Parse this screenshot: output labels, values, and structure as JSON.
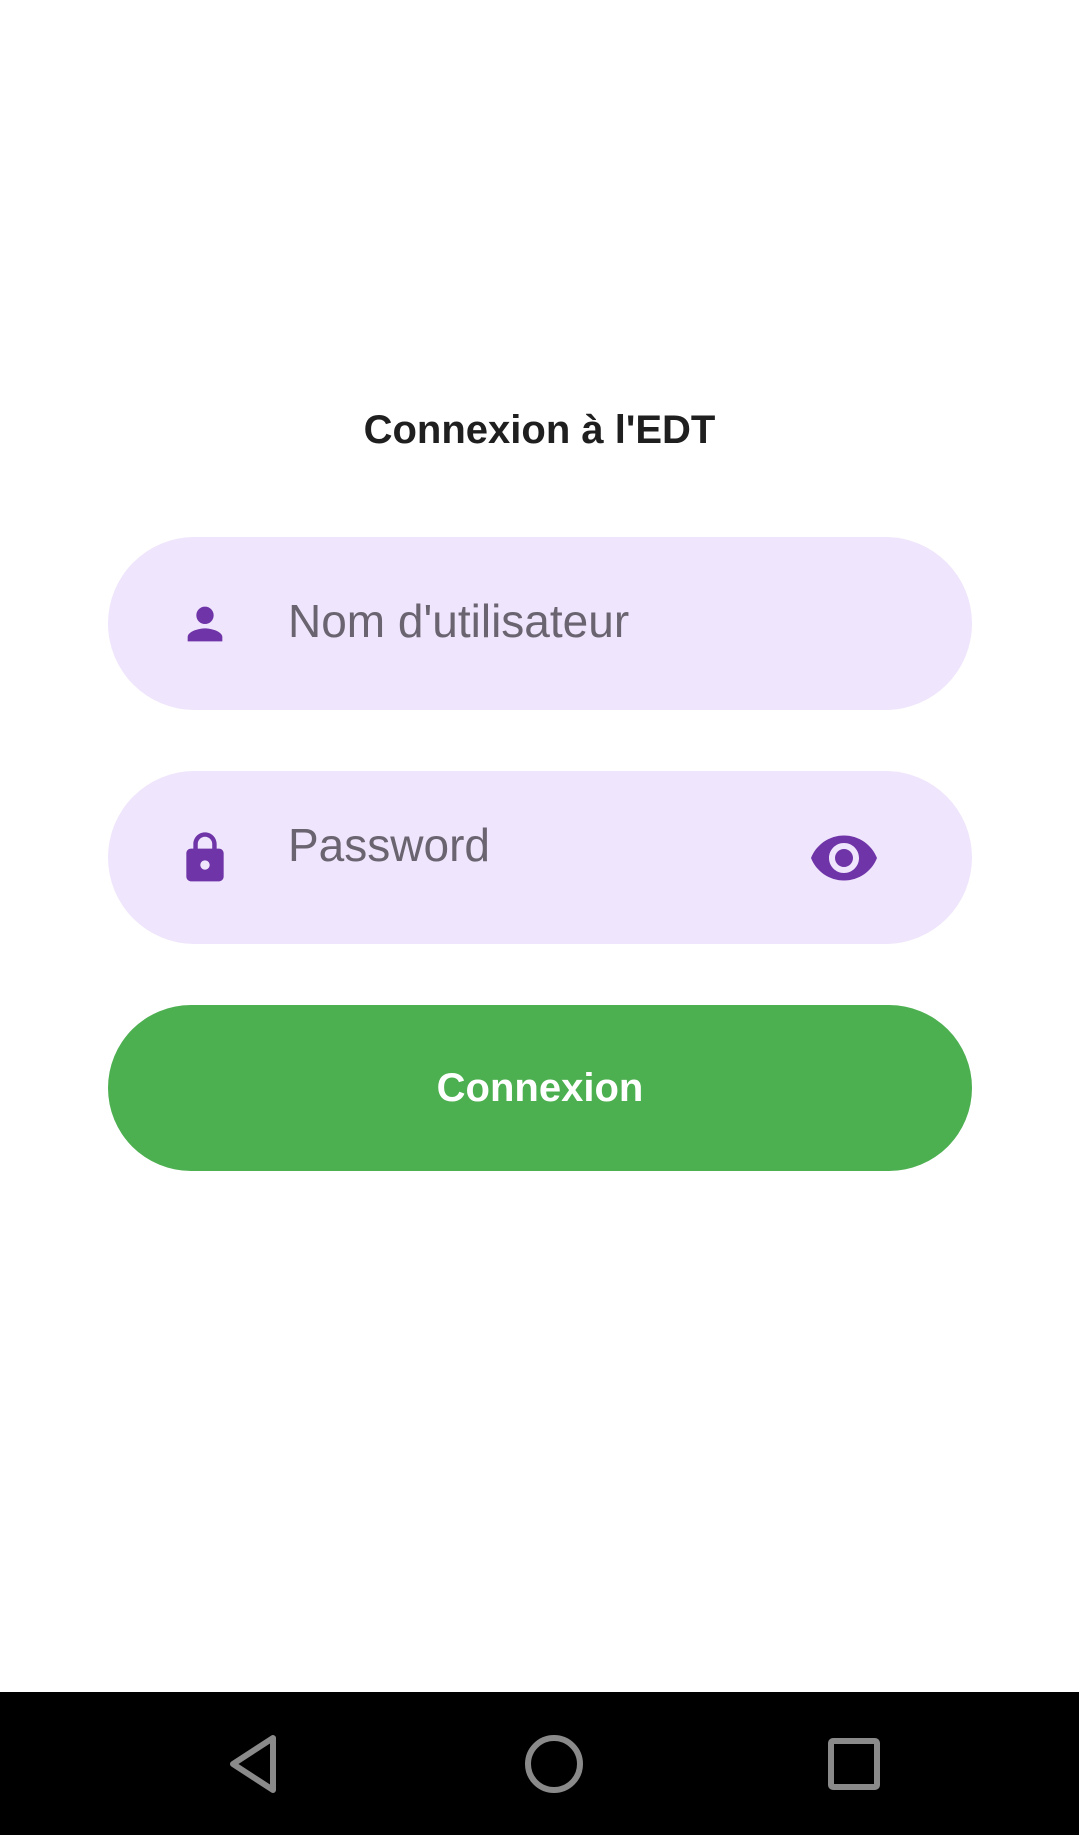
{
  "screen": {
    "title": "Connexion à l'EDT"
  },
  "username_field": {
    "placeholder": "Nom d'utilisateur",
    "value": "",
    "icon": "person-icon"
  },
  "password_field": {
    "placeholder": "Password",
    "value": "",
    "icon": "lock-icon",
    "toggle_icon": "eye-icon"
  },
  "login_button": {
    "label": "Connexion"
  },
  "navbar": {
    "back_icon": "back-triangle-icon",
    "home_icon": "home-circle-icon",
    "recents_icon": "recents-square-icon"
  },
  "colors": {
    "accent": "#6f35a8",
    "field_background": "#efe5fc",
    "button_background": "#4caf50",
    "navbar_background": "#000000"
  }
}
